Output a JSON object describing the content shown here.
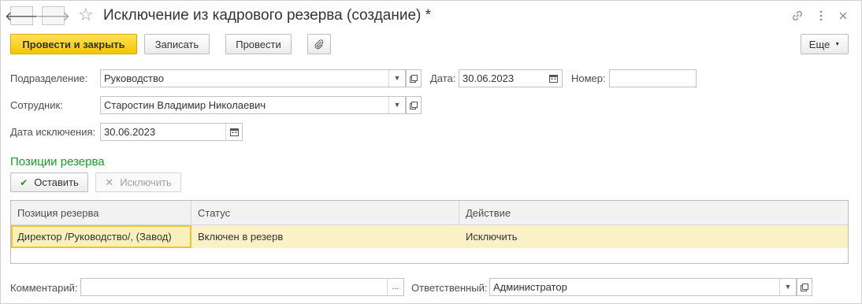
{
  "window": {
    "title": "Исключение из кадрового резерва (создание) *",
    "back_icon": "arrow-left-icon",
    "forward_icon": "arrow-right-icon",
    "favorite_icon": "star-icon",
    "link_icon": "link-icon",
    "menu_icon": "more-vertical-icon",
    "close_icon": "close-icon"
  },
  "toolbar": {
    "post_close_label": "Провести и закрыть",
    "save_label": "Записать",
    "post_label": "Провести",
    "attach_icon": "paperclip-icon",
    "more_label": "Еще"
  },
  "form": {
    "department_label": "Подразделение:",
    "department_value": "Руководство",
    "date_label": "Дата:",
    "date_value": "30.06.2023",
    "number_label": "Номер:",
    "number_value": "",
    "employee_label": "Сотрудник:",
    "employee_value": "Старостин Владимир Николаевич",
    "exclusion_date_label": "Дата исключения:",
    "exclusion_date_value": "30.06.2023"
  },
  "reserve": {
    "section_title": "Позиции резерва",
    "keep_label": "Оставить",
    "exclude_label": "Исключить",
    "columns": [
      "Позиция резерва",
      "Статус",
      "Действие"
    ],
    "rows": [
      {
        "position": "Директор /Руководство/, (Завод)",
        "status": "Включен в резерв",
        "action": "Исключить"
      }
    ]
  },
  "footer": {
    "comment_label": "Комментарий:",
    "comment_value": "",
    "comment_button": "...",
    "responsible_label": "Ответственный:",
    "responsible_value": "Администратор"
  },
  "colors": {
    "primary_button": "#f6c500",
    "section_title": "#1b9a2a",
    "selected_row": "#faf2c6"
  }
}
